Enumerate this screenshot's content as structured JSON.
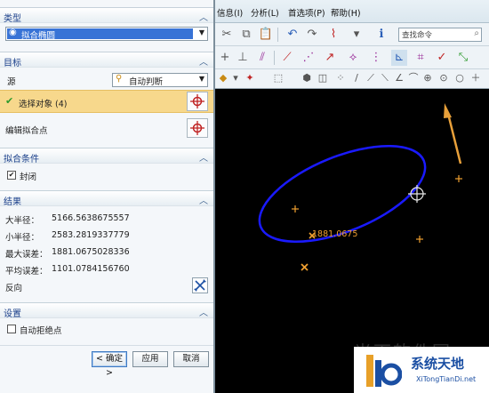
{
  "panel": {
    "type_section": {
      "title": "类型",
      "selected": "拟合椭圆"
    },
    "target_section": {
      "title": "目标",
      "source_label": "源",
      "source_value": "自动判断",
      "select_object_label": "选择对象 (4)",
      "edit_points_label": "编辑拟合点"
    },
    "conditions_section": {
      "title": "拟合条件",
      "closed_label": "封闭",
      "closed_checked": true
    },
    "results_section": {
      "title": "结果",
      "rows": [
        {
          "label": "大半径：",
          "value": "5166.5638675557"
        },
        {
          "label": "小半径：",
          "value": "2583.2819337779"
        },
        {
          "label": "最大误差：",
          "value": "1881.0675028336"
        },
        {
          "label": "平均误差：",
          "value": "1101.0784156760"
        }
      ],
      "reverse_label": "反向"
    },
    "settings_section": {
      "title": "设置",
      "auto_reject_label": "自动拒绝点",
      "auto_reject_checked": false
    },
    "buttons": {
      "ok": "< 确定 >",
      "apply": "应用",
      "cancel": "取消"
    }
  },
  "menubar": {
    "items": [
      "信息(I)",
      "分析(L)",
      "首选项(P)",
      "帮助(H)"
    ]
  },
  "toolbar": {
    "search_placeholder": "查找命令"
  },
  "canvas": {
    "annotation": "1881.0675"
  },
  "watermark": {
    "text": "光下软件园",
    "logo_title": "系统天地",
    "logo_sub": "XiTongTianDi.net"
  },
  "colors": {
    "ellipse": "#1a1aff",
    "points": "#f0a030",
    "highlight_row": "#f7d88c",
    "selection": "#3873d6"
  }
}
